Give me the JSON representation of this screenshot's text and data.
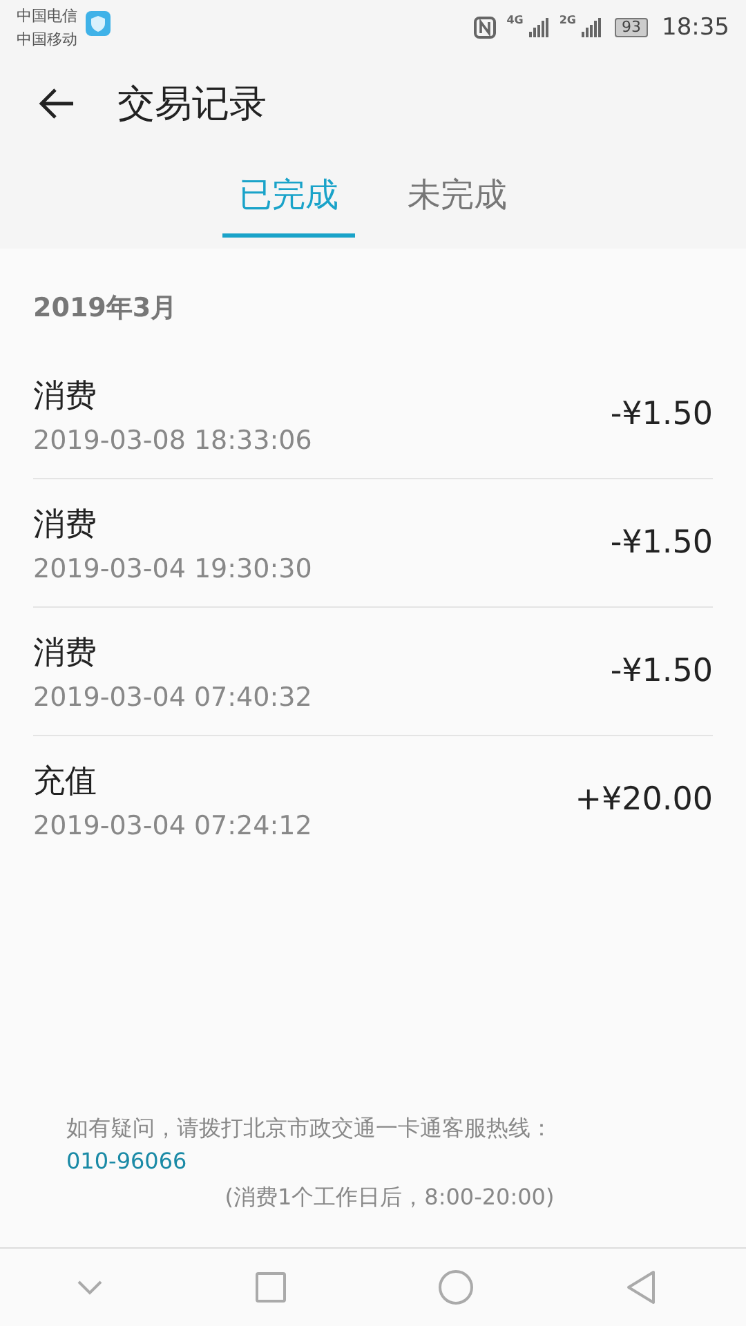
{
  "status_bar": {
    "carriers": [
      "中国电信",
      "中国移动"
    ],
    "network_1": "4G",
    "network_2": "2G",
    "battery": "93",
    "time": "18:35"
  },
  "header": {
    "title": "交易记录"
  },
  "tabs": [
    {
      "label": "已完成",
      "selected": true
    },
    {
      "label": "未完成",
      "selected": false
    }
  ],
  "month": "2019年3月",
  "transactions": [
    {
      "type": "消费",
      "time": "2019-03-08 18:33:06",
      "amount": "-¥1.50"
    },
    {
      "type": "消费",
      "time": "2019-03-04 19:30:30",
      "amount": "-¥1.50"
    },
    {
      "type": "消费",
      "time": "2019-03-04 07:40:32",
      "amount": "-¥1.50"
    },
    {
      "type": "充值",
      "time": "2019-03-04 07:24:12",
      "amount": "+¥20.00"
    }
  ],
  "footer": {
    "notice": "如有疑问，请拨打北京市政交通一卡通客服热线：",
    "phone": "010-96066",
    "hours": "(消费1个工作日后，8:00-20:00)"
  }
}
